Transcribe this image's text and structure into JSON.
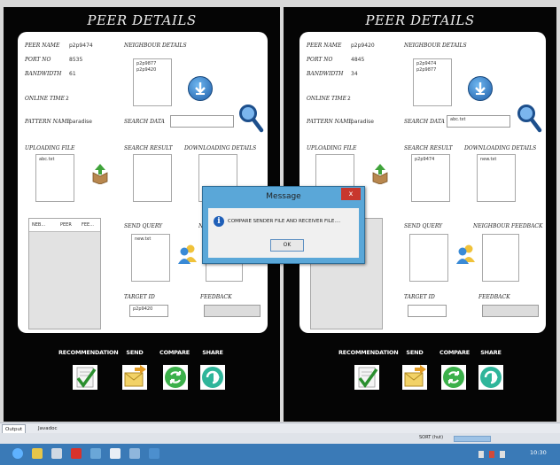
{
  "peers": [
    {
      "title": "PEER DETAILS",
      "peer_name_label": "PEER NAME",
      "peer_name": "p2p9474",
      "port_label": "PORT NO",
      "port": "8535",
      "bandwidth_label": "BANDWIDTH",
      "bandwidth": "61",
      "online_time_label": "ONLINE TIME",
      "online_time": "2",
      "pattern_label": "PATTERN NAME",
      "pattern": "paradise",
      "neighbour_label": "NEIGHBOUR DETAILS",
      "neighbours": [
        "p2p9877",
        "p2p9420"
      ],
      "search_label": "SEARCH DATA",
      "search_value": "",
      "uploading_label": "UPLOADING FILE",
      "uploading": [
        "abc.txt"
      ],
      "search_result_label": "SEARCH RESULT",
      "search_results": [],
      "downloading_label": "DOWNLOADING DETAILS",
      "downloads": [],
      "send_query_label": "SEND QUERY",
      "send_query": [
        "new.txt"
      ],
      "neighbour_feedback_label": "NEIGHBOUR FEEDBACK",
      "table_headers": [
        "NEB...",
        "PEER",
        "FEE..."
      ],
      "target_label": "TARGET ID",
      "target_value": "p2p9420",
      "feedback_label": "FEEDBACK",
      "feedback_value": ""
    },
    {
      "title": "PEER DETAILS",
      "peer_name_label": "PEER NAME",
      "peer_name": "p2p9420",
      "port_label": "PORT NO",
      "port": "4845",
      "bandwidth_label": "BANDWIDTH",
      "bandwidth": "34",
      "online_time_label": "ONLINE TIME",
      "online_time": "2",
      "pattern_label": "PATTERN NAME",
      "pattern": "paradise",
      "neighbour_label": "NEIGHBOUR DETAILS",
      "neighbours": [
        "p2p9474",
        "p2p9877"
      ],
      "search_label": "SEARCH DATA",
      "search_value": "abc.txt",
      "uploading_label": "UPLOADING FILE",
      "uploading": [],
      "search_result_label": "SEARCH RESULT",
      "search_results": [
        "p2p9474"
      ],
      "downloading_label": "DOWNLOADING DETAILS",
      "downloads": [
        "new.txt"
      ],
      "send_query_label": "SEND QUERY",
      "send_query": [],
      "neighbour_feedback_label": "NEIGHBOUR FEEDBACK",
      "table_headers": [],
      "target_label": "TARGET ID",
      "target_value": "",
      "feedback_label": "FEEDBACK",
      "feedback_value": ""
    }
  ],
  "actions": [
    "RECOMMENDATION",
    "SEND",
    "COMPARE",
    "SHARE"
  ],
  "dialog": {
    "title": "Message",
    "close": "x",
    "message": "COMPARE SENDER FILE AND RECEIVER FILE....",
    "ok": "OK"
  },
  "bottom_tabs": [
    "Output",
    "Javadoc"
  ],
  "status_text": "SORT (hut)",
  "clock": "10:30",
  "colors": {
    "accent": "#3a7ab7",
    "dialog": "#5aa7d8",
    "close": "#c8372d",
    "compare": "#3bb04a",
    "share": "#2fb59a"
  },
  "icons": [
    "download-arrow-icon",
    "upload-box-icon",
    "users-icon",
    "search-magnifier-icon",
    "info-icon",
    "recommendation-check-icon",
    "send-mail-icon",
    "compare-icon",
    "share-icon"
  ]
}
